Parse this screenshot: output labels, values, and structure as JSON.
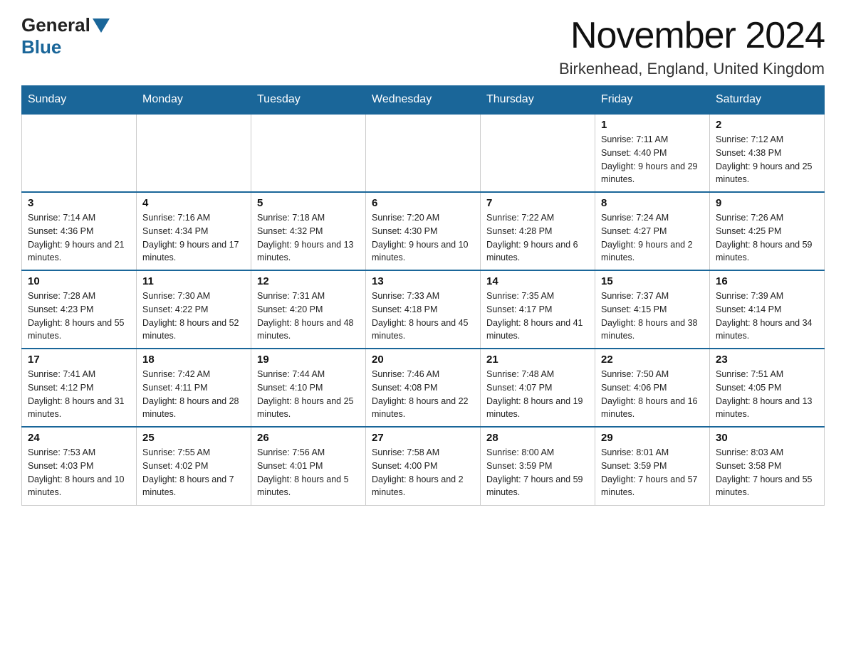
{
  "header": {
    "logo_general": "General",
    "logo_blue": "Blue",
    "month_title": "November 2024",
    "location": "Birkenhead, England, United Kingdom"
  },
  "days_of_week": [
    "Sunday",
    "Monday",
    "Tuesday",
    "Wednesday",
    "Thursday",
    "Friday",
    "Saturday"
  ],
  "weeks": [
    [
      {
        "day": "",
        "info": ""
      },
      {
        "day": "",
        "info": ""
      },
      {
        "day": "",
        "info": ""
      },
      {
        "day": "",
        "info": ""
      },
      {
        "day": "",
        "info": ""
      },
      {
        "day": "1",
        "info": "Sunrise: 7:11 AM\nSunset: 4:40 PM\nDaylight: 9 hours and 29 minutes."
      },
      {
        "day": "2",
        "info": "Sunrise: 7:12 AM\nSunset: 4:38 PM\nDaylight: 9 hours and 25 minutes."
      }
    ],
    [
      {
        "day": "3",
        "info": "Sunrise: 7:14 AM\nSunset: 4:36 PM\nDaylight: 9 hours and 21 minutes."
      },
      {
        "day": "4",
        "info": "Sunrise: 7:16 AM\nSunset: 4:34 PM\nDaylight: 9 hours and 17 minutes."
      },
      {
        "day": "5",
        "info": "Sunrise: 7:18 AM\nSunset: 4:32 PM\nDaylight: 9 hours and 13 minutes."
      },
      {
        "day": "6",
        "info": "Sunrise: 7:20 AM\nSunset: 4:30 PM\nDaylight: 9 hours and 10 minutes."
      },
      {
        "day": "7",
        "info": "Sunrise: 7:22 AM\nSunset: 4:28 PM\nDaylight: 9 hours and 6 minutes."
      },
      {
        "day": "8",
        "info": "Sunrise: 7:24 AM\nSunset: 4:27 PM\nDaylight: 9 hours and 2 minutes."
      },
      {
        "day": "9",
        "info": "Sunrise: 7:26 AM\nSunset: 4:25 PM\nDaylight: 8 hours and 59 minutes."
      }
    ],
    [
      {
        "day": "10",
        "info": "Sunrise: 7:28 AM\nSunset: 4:23 PM\nDaylight: 8 hours and 55 minutes."
      },
      {
        "day": "11",
        "info": "Sunrise: 7:30 AM\nSunset: 4:22 PM\nDaylight: 8 hours and 52 minutes."
      },
      {
        "day": "12",
        "info": "Sunrise: 7:31 AM\nSunset: 4:20 PM\nDaylight: 8 hours and 48 minutes."
      },
      {
        "day": "13",
        "info": "Sunrise: 7:33 AM\nSunset: 4:18 PM\nDaylight: 8 hours and 45 minutes."
      },
      {
        "day": "14",
        "info": "Sunrise: 7:35 AM\nSunset: 4:17 PM\nDaylight: 8 hours and 41 minutes."
      },
      {
        "day": "15",
        "info": "Sunrise: 7:37 AM\nSunset: 4:15 PM\nDaylight: 8 hours and 38 minutes."
      },
      {
        "day": "16",
        "info": "Sunrise: 7:39 AM\nSunset: 4:14 PM\nDaylight: 8 hours and 34 minutes."
      }
    ],
    [
      {
        "day": "17",
        "info": "Sunrise: 7:41 AM\nSunset: 4:12 PM\nDaylight: 8 hours and 31 minutes."
      },
      {
        "day": "18",
        "info": "Sunrise: 7:42 AM\nSunset: 4:11 PM\nDaylight: 8 hours and 28 minutes."
      },
      {
        "day": "19",
        "info": "Sunrise: 7:44 AM\nSunset: 4:10 PM\nDaylight: 8 hours and 25 minutes."
      },
      {
        "day": "20",
        "info": "Sunrise: 7:46 AM\nSunset: 4:08 PM\nDaylight: 8 hours and 22 minutes."
      },
      {
        "day": "21",
        "info": "Sunrise: 7:48 AM\nSunset: 4:07 PM\nDaylight: 8 hours and 19 minutes."
      },
      {
        "day": "22",
        "info": "Sunrise: 7:50 AM\nSunset: 4:06 PM\nDaylight: 8 hours and 16 minutes."
      },
      {
        "day": "23",
        "info": "Sunrise: 7:51 AM\nSunset: 4:05 PM\nDaylight: 8 hours and 13 minutes."
      }
    ],
    [
      {
        "day": "24",
        "info": "Sunrise: 7:53 AM\nSunset: 4:03 PM\nDaylight: 8 hours and 10 minutes."
      },
      {
        "day": "25",
        "info": "Sunrise: 7:55 AM\nSunset: 4:02 PM\nDaylight: 8 hours and 7 minutes."
      },
      {
        "day": "26",
        "info": "Sunrise: 7:56 AM\nSunset: 4:01 PM\nDaylight: 8 hours and 5 minutes."
      },
      {
        "day": "27",
        "info": "Sunrise: 7:58 AM\nSunset: 4:00 PM\nDaylight: 8 hours and 2 minutes."
      },
      {
        "day": "28",
        "info": "Sunrise: 8:00 AM\nSunset: 3:59 PM\nDaylight: 7 hours and 59 minutes."
      },
      {
        "day": "29",
        "info": "Sunrise: 8:01 AM\nSunset: 3:59 PM\nDaylight: 7 hours and 57 minutes."
      },
      {
        "day": "30",
        "info": "Sunrise: 8:03 AM\nSunset: 3:58 PM\nDaylight: 7 hours and 55 minutes."
      }
    ]
  ]
}
